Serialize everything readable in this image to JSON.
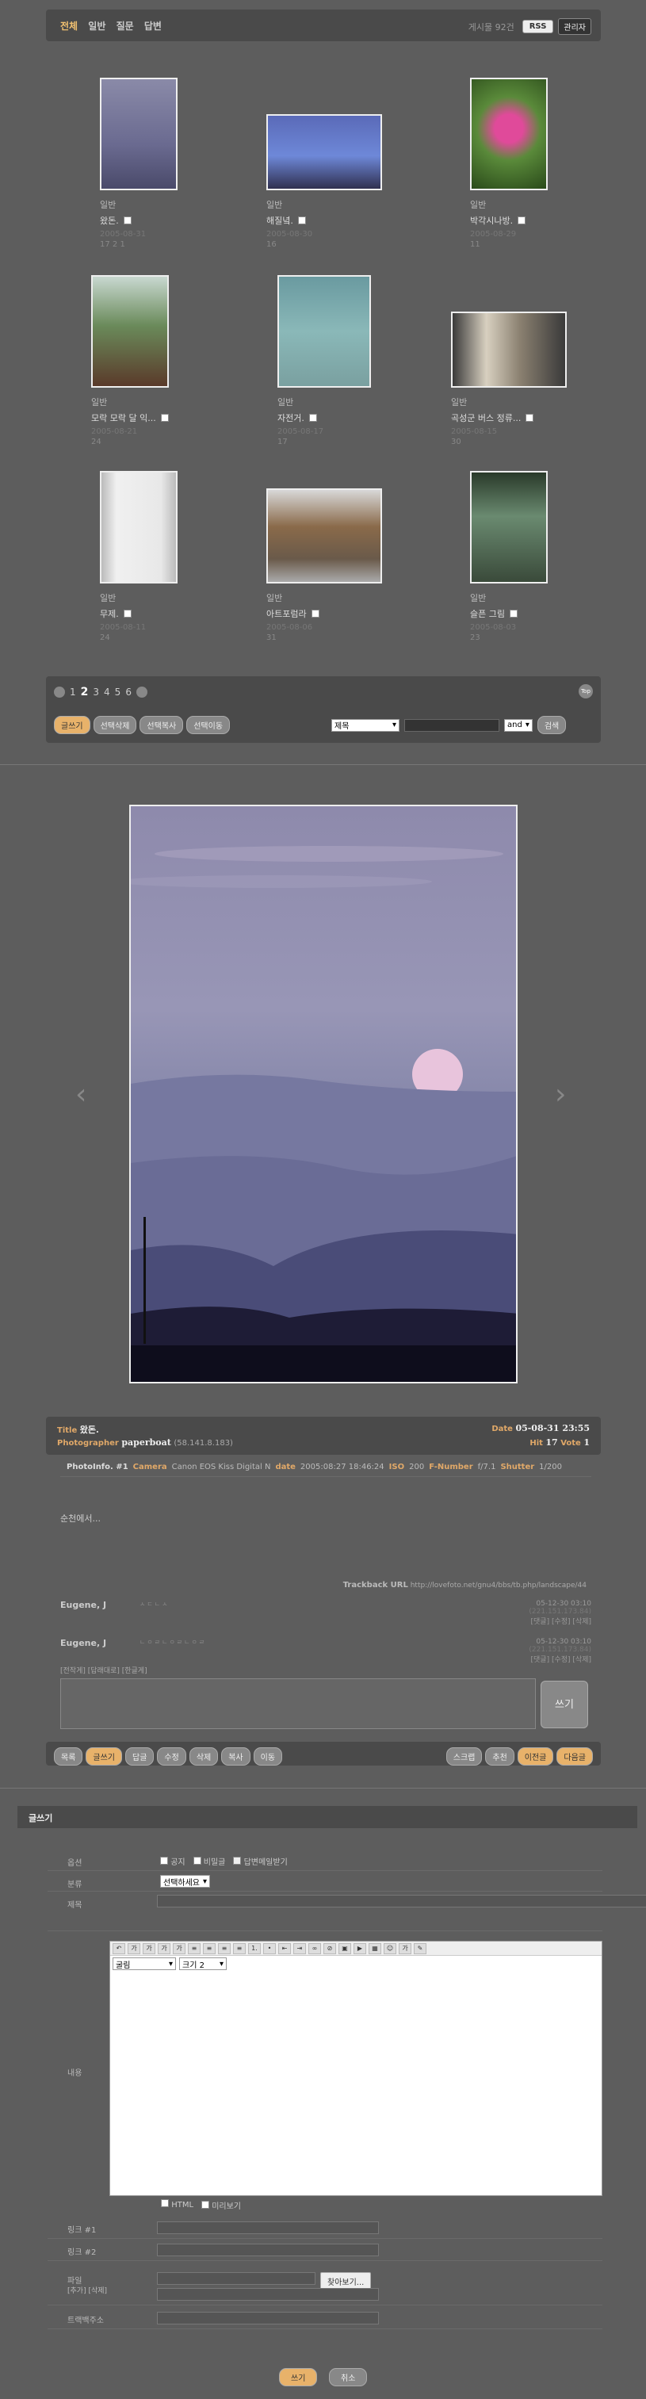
{
  "header": {
    "categories": [
      "전체",
      "일반",
      "질문",
      "답변"
    ],
    "count_text": "게시물 92건",
    "rss": "RSS",
    "admin": "관리자"
  },
  "gallery": [
    {
      "category": "일반",
      "title": "왔돈.",
      "date": "2005-08-31",
      "count": "17"
    },
    {
      "category": "일반",
      "title": "해질녘.",
      "date": "2005-08-30",
      "count": "16"
    },
    {
      "category": "일반",
      "title": "박각시나방.",
      "date": "2005-08-29",
      "count": "11"
    },
    {
      "category": "일반",
      "title": "모락 모락 달 익...",
      "date": "2005-08-21",
      "count": "24"
    },
    {
      "category": "일반",
      "title": "자전거.",
      "date": "2005-08-17",
      "count": "17"
    },
    {
      "category": "일반",
      "title": "곡성군 버스 정류...",
      "date": "2005-08-15",
      "count": "30"
    },
    {
      "category": "일반",
      "title": "무제.",
      "date": "2005-08-11",
      "count": "24"
    },
    {
      "category": "일반",
      "title": "아트포럼라",
      "date": "2005-08-06",
      "count": "31"
    },
    {
      "category": "일반",
      "title": "슬픈 그림",
      "date": "2005-08-03",
      "count": "23"
    }
  ],
  "comment_marker": "17 2 1",
  "pager": {
    "pages": [
      "1",
      "2",
      "3",
      "4",
      "5",
      "6"
    ],
    "current": "2",
    "top": "Top",
    "buttons": [
      "글쓰기",
      "선택삭제",
      "선택복사",
      "선택이동"
    ],
    "search_field": "제목",
    "search_op": "and",
    "search_btn": "검색"
  },
  "view": {
    "title_label": "Title",
    "title": "왔돈.",
    "photographer_label": "Photographer",
    "photographer": "paperboat",
    "ip": "(58.141.8.183)",
    "date_label": "Date",
    "date": "05-08-31 23:55",
    "hit_label": "Hit",
    "hit": "17",
    "vote_label": "Vote",
    "vote": "1",
    "exif_title": "PhotoInfo. #1",
    "camera_label": "Camera",
    "camera": "Canon EOS Kiss Digital N",
    "exif_date_label": "date",
    "exif_date": "2005:08:27 18:46:24",
    "iso_label": "ISO",
    "iso": "200",
    "fnumber_label": "F-Number",
    "fnumber": "f/7.1",
    "shutter_label": "Shutter",
    "shutter": "1/200",
    "content": "순천에서...",
    "trackback_label": "Trackback URL",
    "trackback": "http://lovefoto.net/gnu4/bbs/tb.php/landscape/44"
  },
  "comments": [
    {
      "name": "Eugene, J",
      "body": "ㅅㄷㄴㅅ",
      "date": "05-12-30 03:10",
      "ip": "(221.151.173.84)",
      "actions": "[댓글] [수정] [삭제]"
    },
    {
      "name": "Eugene, J",
      "body": "ㄴㅇㄹㄴㅇㄹㄴㅇㄹ",
      "date": "05-12-30 03:10",
      "ip": "(221.151.173.84)",
      "actions": "[댓글] [수정] [삭제]"
    }
  ],
  "comment_form": {
    "tabs": "[전작게] [답래대로] [한글게]",
    "submit": "쓰기"
  },
  "actions": {
    "left": [
      "목록",
      "글쓰기",
      "답글",
      "수정",
      "삭제",
      "복사",
      "이동"
    ],
    "right": [
      "스크랩",
      "추천",
      "이전글",
      "다음글"
    ]
  },
  "write": {
    "title": "글쓰기",
    "option_label": "옵션",
    "opt_notice": "공지",
    "opt_secret": "비밀글",
    "opt_mail": "답변메일받기",
    "cat_label": "분류",
    "cat_value": "선택하세요",
    "subject_label": "제목",
    "content_label": "내용",
    "font_select": "굴림",
    "size_select": "크기 2",
    "html_label": "HTML",
    "preview_label": "미리보기",
    "link1_label": "링크 #1",
    "link2_label": "링크 #2",
    "file_label": "파일",
    "file_sub": "[추가] [삭제]",
    "browse": "찾아보기...",
    "trackback_label": "트랙백주소",
    "submit": "쓰기",
    "cancel": "취소"
  }
}
